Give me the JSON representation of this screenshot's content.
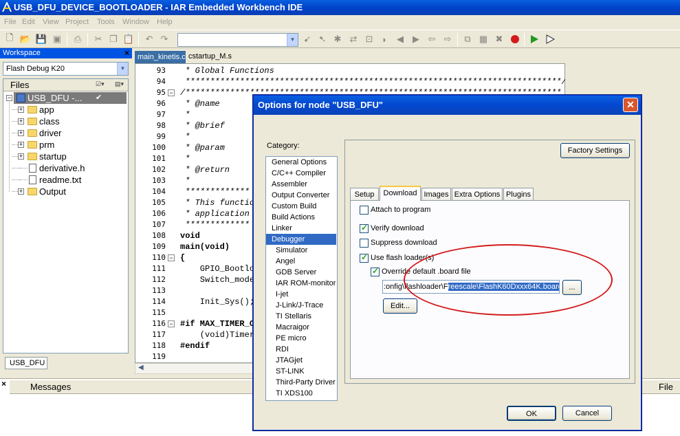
{
  "window": {
    "title": "USB_DFU_DEVICE_BOOTLOADER - IAR Embedded Workbench IDE",
    "icon": "iar-app-icon"
  },
  "menubar": [
    "File",
    "Edit",
    "View",
    "Project",
    "Tools",
    "Window",
    "Help"
  ],
  "workspace": {
    "title": "Workspace",
    "configuration": "Flash Debug K20",
    "files_header": "Files",
    "project": "USB_DFU -...",
    "items": [
      {
        "label": "app",
        "type": "folder"
      },
      {
        "label": "class",
        "type": "folder"
      },
      {
        "label": "driver",
        "type": "folder"
      },
      {
        "label": "prm",
        "type": "folder"
      },
      {
        "label": "startup",
        "type": "folder"
      },
      {
        "label": "derivative.h",
        "type": "header"
      },
      {
        "label": "readme.txt",
        "type": "text"
      },
      {
        "label": "Output",
        "type": "folder"
      }
    ],
    "tab": "USB_DFU"
  },
  "editor": {
    "tabs": [
      "main_kinetis.c",
      "cstartup_M.s"
    ],
    "lines": [
      {
        "n": "93",
        "t": " * Global Functions"
      },
      {
        "n": "94",
        "t": " ****************************************************************************/"
      },
      {
        "n": "95",
        "t": "/****************************************************************************"
      },
      {
        "n": "96",
        "t": " * @name"
      },
      {
        "n": "97",
        "t": " *"
      },
      {
        "n": "98",
        "t": " * @brief"
      },
      {
        "n": "99",
        "t": " *"
      },
      {
        "n": "100",
        "t": " * @param"
      },
      {
        "n": "101",
        "t": " *"
      },
      {
        "n": "102",
        "t": " * @return"
      },
      {
        "n": "103",
        "t": " *"
      },
      {
        "n": "104",
        "t": " *************"
      },
      {
        "n": "105",
        "t": " * This function"
      },
      {
        "n": "106",
        "t": " * application"
      },
      {
        "n": "107",
        "t": " *************"
      },
      {
        "n": "108",
        "t": "void"
      },
      {
        "n": "109",
        "t": "main(void)"
      },
      {
        "n": "110",
        "t": "{"
      },
      {
        "n": "111",
        "t": "    GPIO_Bootlo"
      },
      {
        "n": "112",
        "t": "    Switch_mode"
      },
      {
        "n": "113",
        "t": ""
      },
      {
        "n": "114",
        "t": "    Init_Sys();"
      },
      {
        "n": "115",
        "t": ""
      },
      {
        "n": "116",
        "t": "#if MAX_TIMER_OI"
      },
      {
        "n": "117",
        "t": "    (void)Timer"
      },
      {
        "n": "118",
        "t": "#endif"
      },
      {
        "n": "119",
        "t": ""
      }
    ]
  },
  "messages": {
    "title": "Messages",
    "file_col": "File"
  },
  "dialog": {
    "title": "Options for node \"USB_DFU\"",
    "category_label": "Category:",
    "categories": [
      {
        "label": "General Options",
        "level": 0
      },
      {
        "label": "C/C++ Compiler",
        "level": 0
      },
      {
        "label": "Assembler",
        "level": 0
      },
      {
        "label": "Output Converter",
        "level": 0
      },
      {
        "label": "Custom Build",
        "level": 0
      },
      {
        "label": "Build Actions",
        "level": 0
      },
      {
        "label": "Linker",
        "level": 0
      },
      {
        "label": "Debugger",
        "level": 0,
        "selected": true
      },
      {
        "label": "Simulator",
        "level": 1
      },
      {
        "label": "Angel",
        "level": 1
      },
      {
        "label": "GDB Server",
        "level": 1
      },
      {
        "label": "IAR ROM-monitor",
        "level": 1
      },
      {
        "label": "I-jet",
        "level": 1
      },
      {
        "label": "J-Link/J-Trace",
        "level": 1
      },
      {
        "label": "TI Stellaris",
        "level": 1
      },
      {
        "label": "Macraigor",
        "level": 1
      },
      {
        "label": "PE micro",
        "level": 1
      },
      {
        "label": "RDI",
        "level": 1
      },
      {
        "label": "JTAGjet",
        "level": 1
      },
      {
        "label": "ST-LINK",
        "level": 1
      },
      {
        "label": "Third-Party Driver",
        "level": 1
      },
      {
        "label": "TI XDS100",
        "level": 1
      }
    ],
    "factory_settings": "Factory Settings",
    "tabs": [
      "Setup",
      "Download",
      "Images",
      "Extra Options",
      "Plugins"
    ],
    "active_tab": "Download",
    "options": {
      "attach": {
        "label": "Attach to program",
        "checked": false
      },
      "verify": {
        "label": "Verify download",
        "checked": true
      },
      "suppress": {
        "label": "Suppress download",
        "checked": false
      },
      "flash_loader": {
        "label": "Use flash loader(s)",
        "checked": true
      },
      "override": {
        "label": "Override default .board file",
        "checked": true
      }
    },
    "board_path_prefix": ":onfig\\flashloader\\F",
    "board_path_selected": "reescale\\FlashK60Dxxx64K.board",
    "browse": "...",
    "edit": "Edit...",
    "ok": "OK",
    "cancel": "Cancel"
  },
  "colors": {
    "titlebar": "#0054e3",
    "selection": "#316ac5",
    "annotation": "#d31b1b"
  }
}
